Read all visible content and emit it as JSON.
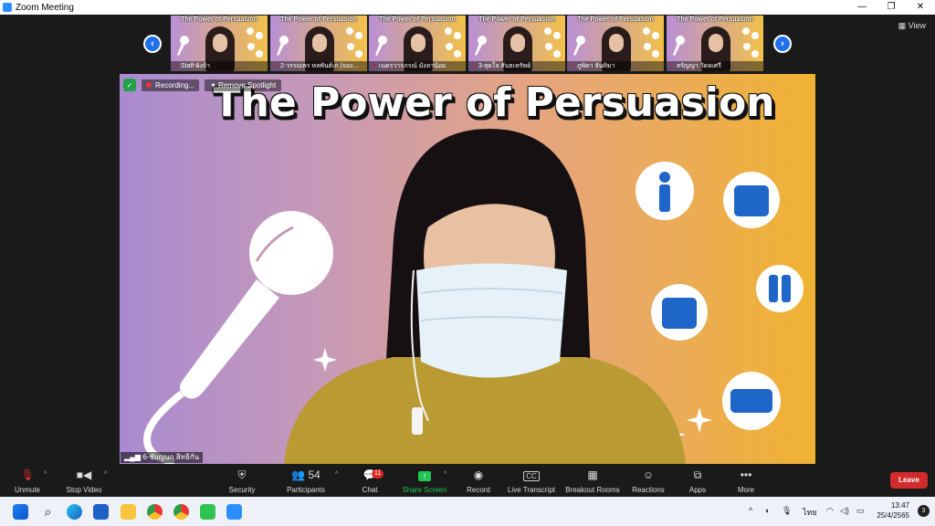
{
  "window": {
    "title": "Zoom Meeting",
    "controls": [
      "—",
      "❐",
      "✕"
    ]
  },
  "view_label": "View",
  "gallery": {
    "slide_title": "The Power of Persuasion",
    "participants": [
      {
        "name": "Staff-ผิงจ้า"
      },
      {
        "name": "2-วรรณพร หลพันธ์เก (จอง..."
      },
      {
        "name": "เนตรวารภรณ์ มังลาน้อย"
      },
      {
        "name": "3-สุดใจ สันธเทรัพย์"
      },
      {
        "name": "ภูพิดา จันทิมา"
      },
      {
        "name": "สรัญญา วัดยเศรี"
      }
    ]
  },
  "stage": {
    "slide_title": "The Power of Persuasion",
    "recording_label": "Recording...",
    "spotlight_label": "Remove Spotlight",
    "speaker_name": "6-ชัยญนก สิทธิกัน"
  },
  "toolbar": {
    "unmute": "Unmute",
    "stop_video": "Stop Video",
    "security": "Security",
    "participants": "Participants",
    "participants_count": "54",
    "chat": "Chat",
    "chat_badge": "11",
    "share_screen": "Share Screen",
    "record": "Record",
    "live_transcript": "Live Transcript",
    "breakout_rooms": "Breakout Rooms",
    "reactions": "Reactions",
    "apps": "Apps",
    "more": "More",
    "leave": "Leave"
  },
  "taskbar": {
    "language": "ไทย",
    "time": "13:47",
    "date": "25/4/2565",
    "notification_count": "3"
  },
  "colors": {
    "accent": "#2d8cff",
    "leave": "#d12b2b",
    "share": "#23c552",
    "recording": "#e33333"
  }
}
